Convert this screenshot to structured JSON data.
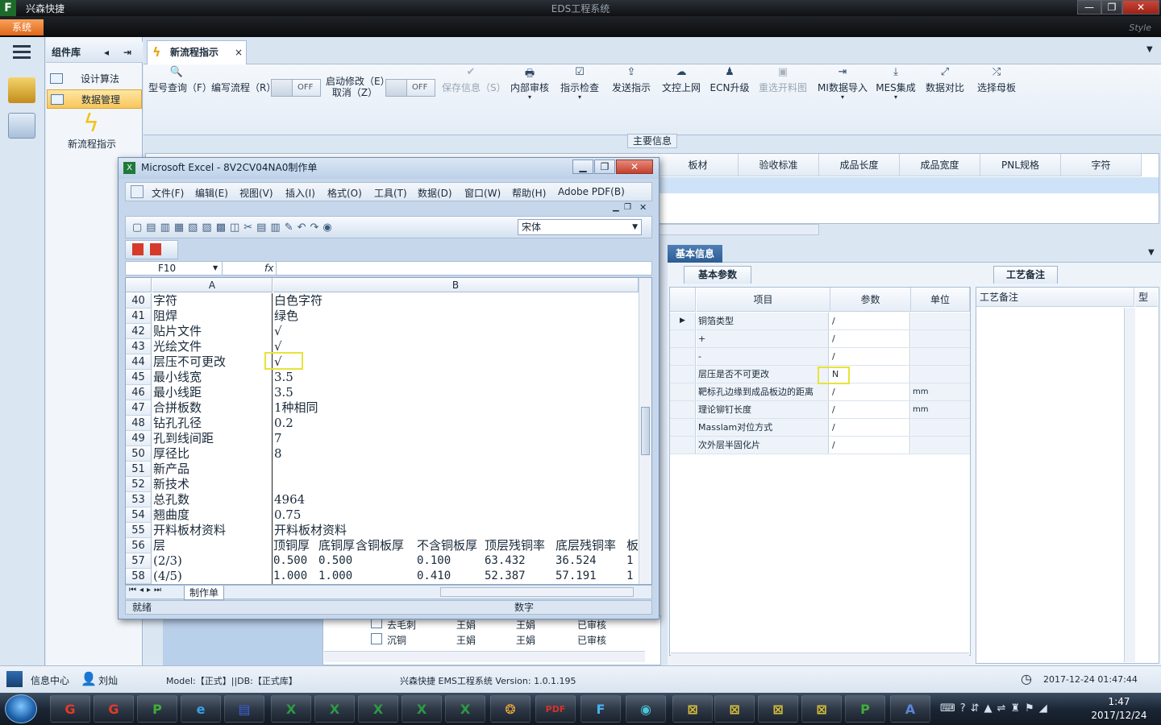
{
  "app": {
    "title": "兴森快捷",
    "window_title": "EDS工程系统",
    "system_button": "系统",
    "style_label": "Style",
    "controls": {
      "minimize": "—",
      "maximize": "❐",
      "close": "✕"
    }
  },
  "component_library": {
    "title": "组件库",
    "items": [
      {
        "label": "设计算法",
        "selected": false
      },
      {
        "label": "数据管理",
        "selected": true
      }
    ],
    "big_item": "新流程指示"
  },
  "tab": {
    "label": "新流程指示",
    "close": "×"
  },
  "ribbon": {
    "query": "型号查询（F）",
    "write_flow": "编写流程（R）",
    "toggle_text": "OFF",
    "startup_edit_line1": "启动修改（E）",
    "startup_edit_line2": "取消（Z）",
    "buttons": [
      {
        "label": "保存信息（S）",
        "icon": "✔",
        "disabled": true,
        "dropdown": false
      },
      {
        "label": "内部审核",
        "icon": "🖶",
        "disabled": false,
        "dropdown": true
      },
      {
        "label": "指示检查",
        "icon": "☑",
        "disabled": false,
        "dropdown": true
      },
      {
        "label": "发送指示",
        "icon": "⇪",
        "disabled": false,
        "dropdown": false
      },
      {
        "label": "文控上网",
        "icon": "☁",
        "disabled": false,
        "dropdown": false
      },
      {
        "label": "ECN升级",
        "icon": "♟",
        "disabled": false,
        "dropdown": false
      },
      {
        "label": "重选开料图",
        "icon": "▣",
        "disabled": true,
        "dropdown": false
      },
      {
        "label": "MI数据导入",
        "icon": "⇥",
        "disabled": false,
        "dropdown": true
      },
      {
        "label": "MES集成",
        "icon": "⤓",
        "disabled": false,
        "dropdown": true
      },
      {
        "label": "数据对比",
        "icon": "⤢",
        "disabled": false,
        "dropdown": false
      },
      {
        "label": "选择母板",
        "icon": "⤮",
        "disabled": false,
        "dropdown": false
      }
    ]
  },
  "main_info": {
    "title": "主要信息",
    "columns": [
      "板材",
      "验收标准",
      "成品长度",
      "成品宽度",
      "PNL规格",
      "字符"
    ]
  },
  "basic_info": {
    "tab": "基本信息",
    "sub_tab": "基本参数",
    "process_tab": "工艺备注",
    "process_header": "工艺备注",
    "process_col2": "型",
    "columns": [
      "项目",
      "参数",
      "单位"
    ],
    "rows": [
      {
        "item": "铜箔类型",
        "param": "/",
        "unit": ""
      },
      {
        "item": "+",
        "param": "/",
        "unit": ""
      },
      {
        "item": "-",
        "param": "/",
        "unit": ""
      },
      {
        "item": "层压是否不可更改",
        "param": "N",
        "unit": ""
      },
      {
        "item": "靶标孔边缘到成品板边的距离",
        "param": "/",
        "unit": "mm"
      },
      {
        "item": "理论铆钉长度",
        "param": "/",
        "unit": "mm"
      },
      {
        "item": "Masslam对位方式",
        "param": "/",
        "unit": ""
      },
      {
        "item": "次外层半固化片",
        "param": "/",
        "unit": ""
      }
    ]
  },
  "bottom_tree": [
    {
      "name": "去毛刺",
      "a": "王娟",
      "b": "王娟",
      "status": "已审核"
    },
    {
      "name": "沉铜",
      "a": "王娟",
      "b": "王娟",
      "status": "已审核"
    }
  ],
  "excel": {
    "title": "Microsoft Excel - 8V2CV04NA0制作单",
    "menu": [
      "文件(F)",
      "编辑(E)",
      "视图(V)",
      "插入(I)",
      "格式(O)",
      "工具(T)",
      "数据(D)",
      "窗口(W)",
      "帮助(H)",
      "Adobe PDF(B)"
    ],
    "font": "宋体",
    "cell_ref": "F10",
    "fx": "fx",
    "col_a": "A",
    "col_b": "B",
    "rows": [
      {
        "n": "40",
        "a": "字符",
        "b": "白色字符"
      },
      {
        "n": "41",
        "a": "阻焊",
        "b": "绿色"
      },
      {
        "n": "42",
        "a": "贴片文件",
        "b": "√"
      },
      {
        "n": "43",
        "a": "光绘文件",
        "b": "√"
      },
      {
        "n": "44",
        "a": "层压不可更改",
        "b": "√"
      },
      {
        "n": "45",
        "a": "最小线宽",
        "b": "3.5"
      },
      {
        "n": "46",
        "a": "最小线距",
        "b": "3.5"
      },
      {
        "n": "47",
        "a": "合拼板数",
        "b": "1种相同"
      },
      {
        "n": "48",
        "a": "钻孔孔径",
        "b": "0.2"
      },
      {
        "n": "49",
        "a": "孔到线间距",
        "b": "7"
      },
      {
        "n": "50",
        "a": "厚径比",
        "b": "8"
      },
      {
        "n": "51",
        "a": "新产品",
        "b": ""
      },
      {
        "n": "52",
        "a": "新技术",
        "b": ""
      },
      {
        "n": "53",
        "a": "总孔数",
        "b": "4964"
      },
      {
        "n": "54",
        "a": "翘曲度",
        "b": "0.75"
      },
      {
        "n": "55",
        "a": "开料板材资料",
        "b": "开料板材资料"
      }
    ],
    "row56": {
      "n": "56",
      "a": "层",
      "cols": [
        "顶铜厚",
        "底铜厚",
        "含铜板厚",
        "不含铜板厚",
        "顶层残铜率",
        "底层残铜率",
        "板"
      ]
    },
    "row57": {
      "n": "57",
      "a": "(2/3)",
      "vals": [
        "0.500",
        "0.500",
        "",
        "0.100",
        "63.432",
        "36.524",
        "1"
      ]
    },
    "row58": {
      "n": "58",
      "a": "(4/5)",
      "vals": [
        "1.000",
        "1.000",
        "",
        "0.410",
        "52.387",
        "57.191",
        "1"
      ]
    },
    "sheet_tab": "制作单",
    "status_ready": "就绪",
    "status_num": "数字"
  },
  "statusbar": {
    "info_center": "信息中心",
    "user": "刘灿",
    "model": "Model:【正式】||DB:【正式库】",
    "version": "兴森快捷 EMS工程系统 Version: 1.0.1.195",
    "datetime": "2017-12-24 01:47:44"
  },
  "taskbar": {
    "time": "1:47",
    "date": "2017/12/24"
  },
  "colors": {
    "accent_orange": "#e0661a",
    "highlight_yellow": "#e8e23a",
    "selected_blue": "#2b5c93"
  }
}
